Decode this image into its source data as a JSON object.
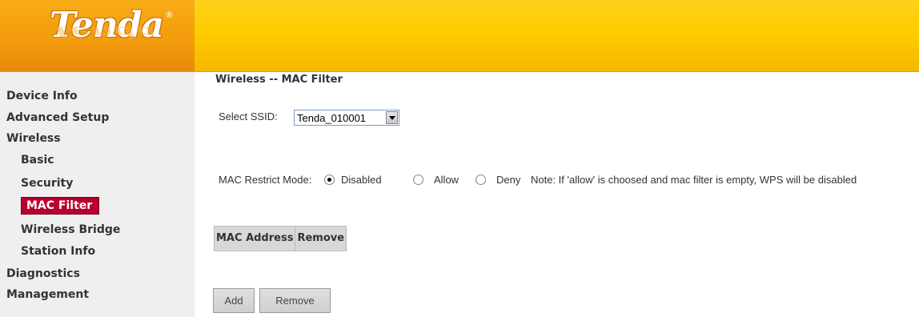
{
  "brand": {
    "logo_text": "Tenda"
  },
  "sidebar": {
    "items": [
      {
        "label": "Device Info"
      },
      {
        "label": "Advanced Setup"
      },
      {
        "label": "Wireless"
      },
      {
        "label": "Basic"
      },
      {
        "label": "Security"
      },
      {
        "label": "MAC Filter",
        "active": true
      },
      {
        "label": "Wireless Bridge"
      },
      {
        "label": "Station Info"
      },
      {
        "label": "Diagnostics"
      },
      {
        "label": "Management"
      }
    ]
  },
  "main": {
    "title": "Wireless -- MAC Filter",
    "ssid_label": "Select SSID:",
    "ssid_value": "Tenda_010001",
    "mode_label": "MAC Restrict Mode:",
    "mode_options": [
      {
        "label": "Disabled",
        "checked": true
      },
      {
        "label": "Allow",
        "checked": false
      },
      {
        "label": "Deny",
        "checked": false
      }
    ],
    "note": "Note: If 'allow' is choosed and mac filter is empty, WPS will be disabled",
    "table_headers": [
      "MAC Address",
      "Remove"
    ],
    "buttons": {
      "add": "Add",
      "remove": "Remove"
    }
  },
  "colors": {
    "header": "#ffcc00",
    "logo_bg": "#f39a0c",
    "active_nav": "#b8002e",
    "sidebar": "#efefef"
  }
}
